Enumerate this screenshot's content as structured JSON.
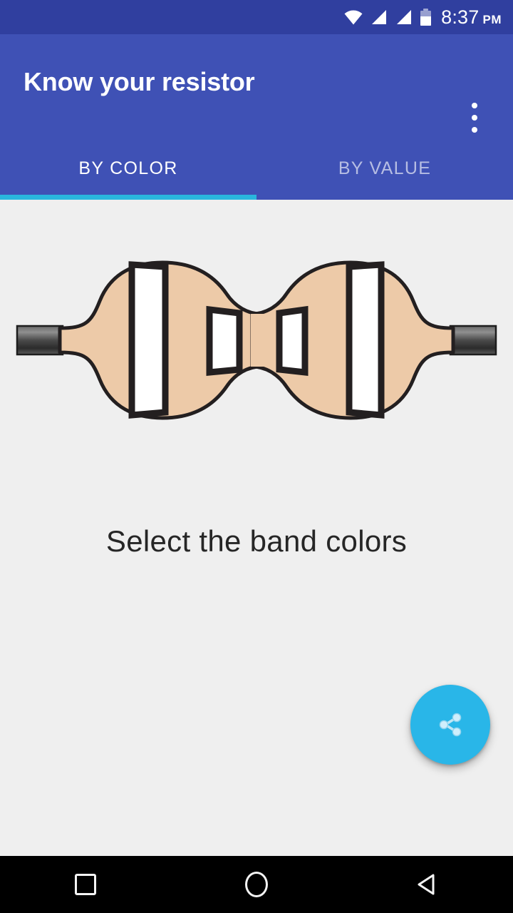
{
  "status_bar": {
    "time": "8:37",
    "ampm": "PM",
    "icons": [
      "wifi-icon",
      "signal-icon",
      "signal-icon",
      "battery-icon"
    ],
    "background_color": "#303F9F"
  },
  "app_bar": {
    "title": "Know your resistor",
    "overflow_menu_label": "More options",
    "background_color": "#3F51B5"
  },
  "tabs": {
    "items": [
      {
        "label": "BY COLOR",
        "active": true
      },
      {
        "label": "BY VALUE",
        "active": false
      }
    ],
    "indicator_color": "#29B6DD"
  },
  "main": {
    "hint": "Select the band colors",
    "background_color": "#EFEFEF",
    "resistor": {
      "body_color": "#EDCAA8",
      "outline_color": "#231F20",
      "lead_color": "#3A3A3A",
      "band_count": 4,
      "bands": [
        {
          "index": 1,
          "color": "#FFFFFF",
          "selected_color_name": "none"
        },
        {
          "index": 2,
          "color": "#FFFFFF",
          "selected_color_name": "none"
        },
        {
          "index": 3,
          "color": "#FFFFFF",
          "selected_color_name": "none"
        },
        {
          "index": 4,
          "color": "#FFFFFF",
          "selected_color_name": "none"
        }
      ]
    }
  },
  "fab": {
    "icon": "share-icon",
    "label": "Share",
    "color": "#29B6E8"
  },
  "nav_bar": {
    "background_color": "#000000",
    "buttons": [
      {
        "name": "recents",
        "icon": "square-icon"
      },
      {
        "name": "home",
        "icon": "circle-icon"
      },
      {
        "name": "back",
        "icon": "triangle-left-icon"
      }
    ]
  }
}
